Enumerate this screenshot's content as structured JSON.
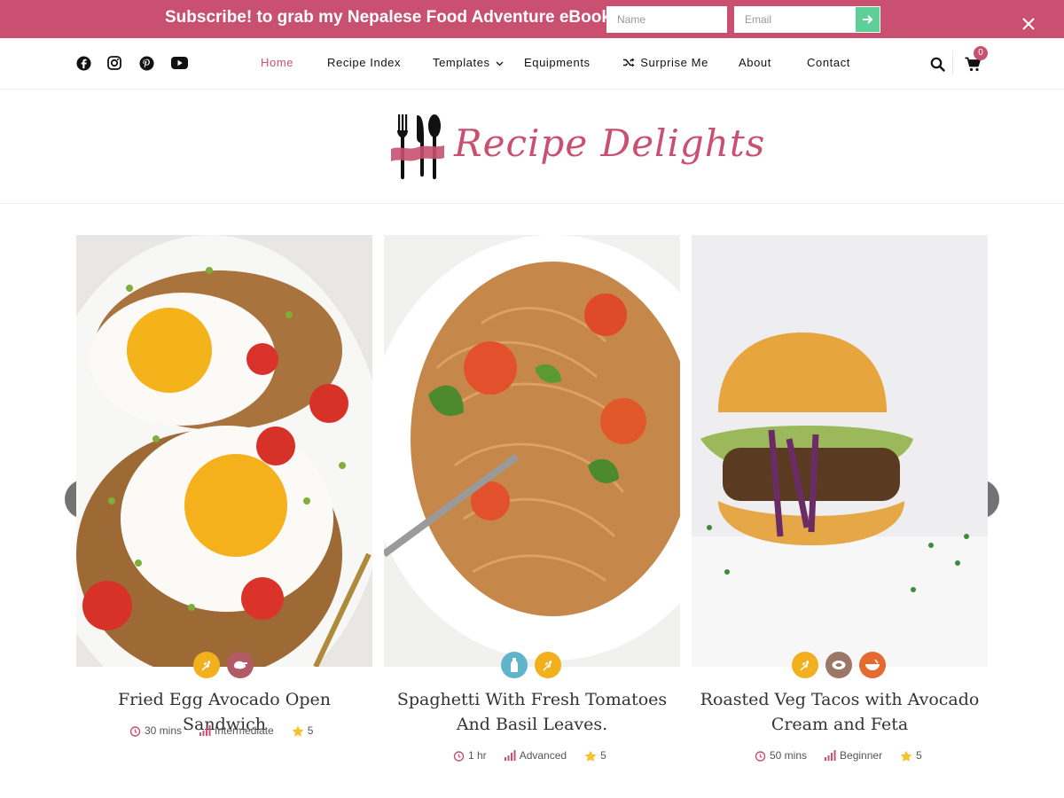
{
  "subscribe": {
    "message": "Subscribe! to grab my Nepalese Food Adventure eBook!",
    "name_placeholder": "Name",
    "email_placeholder": "Email"
  },
  "nav": {
    "items": [
      "Home",
      "Recipe Index",
      "Templates",
      "Equipments",
      "Surprise Me",
      "About",
      "Contact"
    ],
    "active": "Home",
    "cart_count": "0"
  },
  "logo": {
    "text": "Recipe Delights"
  },
  "recipes": [
    {
      "title": "Fried Egg Avocado Open Sandwich",
      "time": "30 mins",
      "difficulty": "Intermediate",
      "rating": "5"
    },
    {
      "title": "Spaghetti With Fresh Tomatoes And Basil Leaves.",
      "time": "1 hr",
      "difficulty": "Advanced",
      "rating": "5"
    },
    {
      "title": "Roasted Veg Tacos with Avocado Cream and Feta",
      "time": "50 mins",
      "difficulty": "Beginner",
      "rating": "5"
    }
  ],
  "colors": {
    "accent": "#c95070",
    "submit": "#5fcf98",
    "badge_yellow": "#f2b01e"
  }
}
